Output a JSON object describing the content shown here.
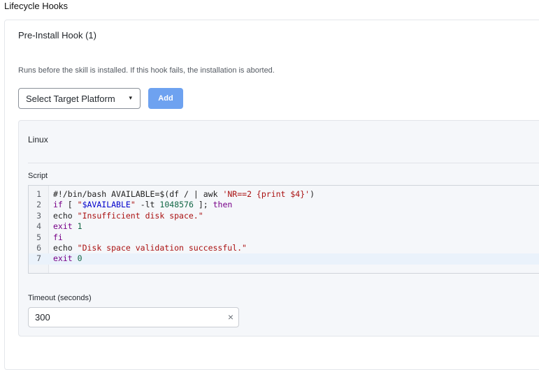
{
  "page": {
    "title": "Lifecycle Hooks"
  },
  "hook": {
    "title": "Pre-Install Hook (1)",
    "description": "Runs before the skill is installed. If this hook fails, the installation is aborted.",
    "platform_select": {
      "value": "Select Target Platform",
      "caret": "▾"
    },
    "add_label": "Add"
  },
  "platform": {
    "name": "Linux",
    "script_label": "Script",
    "code_lines": [
      {
        "n": "1",
        "text": "#!/bin/bash AVAILABLE=$(df / | awk 'NR==2 {print $4}')"
      },
      {
        "n": "2",
        "text": "if [ \"$AVAILABLE\" -lt 1048576 ]; then"
      },
      {
        "n": "3",
        "text": "echo \"Insufficient disk space.\""
      },
      {
        "n": "4",
        "text": "exit 1"
      },
      {
        "n": "5",
        "text": "fi"
      },
      {
        "n": "6",
        "text": "echo \"Disk space validation successful.\""
      },
      {
        "n": "7",
        "text": "exit 0"
      }
    ],
    "active_line": "7",
    "timeout_label": "Timeout (seconds)",
    "timeout_value": "300",
    "clear_glyph": "×"
  },
  "colors": {
    "accent": "#6ea2f0",
    "keyword": "#770088",
    "string": "#aa1111",
    "number": "#116644",
    "variable": "#0000cc"
  }
}
